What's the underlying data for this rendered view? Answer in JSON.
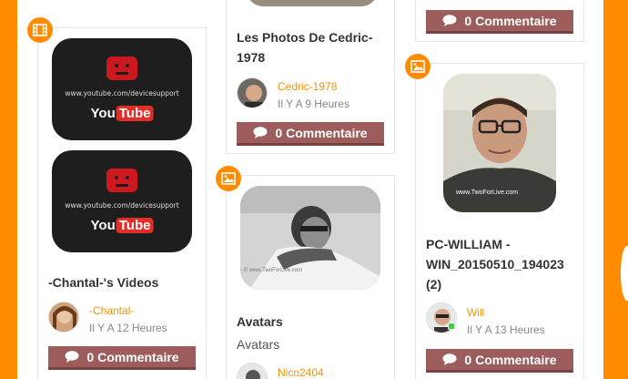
{
  "colors": {
    "accent": "#ff8c00",
    "author": "#f39200",
    "button": "#9e5d5d"
  },
  "column1": {
    "badge_icon": "film-icon",
    "video_url": "www.youtube.com/devicesupport",
    "youtube_you": "You",
    "youtube_tube": "Tube",
    "title": "-Chantal-'s Videos",
    "author": "-Chantal-",
    "time": "Il Y A 12 Heures",
    "comment_label": "0 Commentaire"
  },
  "column2": {
    "top_post": {
      "title": "Les Photos De Cedric-1978",
      "author": "Cedric-1978",
      "time": "Il Y A 9 Heures",
      "comment_label": "0 Commentaire"
    },
    "second_post": {
      "badge_icon": "image-icon",
      "photo_watermark": "- © www.TwoForLive.com",
      "title": "Avatars",
      "description": "Avatars",
      "author": "Nico2404"
    }
  },
  "column3": {
    "top_post": {
      "comment_label": "0 Commentaire"
    },
    "second_post": {
      "badge_icon": "image-icon",
      "photo_watermark": "www.TwoForLive.com",
      "title": "PC-WILLIAM - WIN_20150510_194023 (2)",
      "author": "Will",
      "time": "Il Y A 13 Heures",
      "comment_label": "0 Commentaire"
    }
  }
}
